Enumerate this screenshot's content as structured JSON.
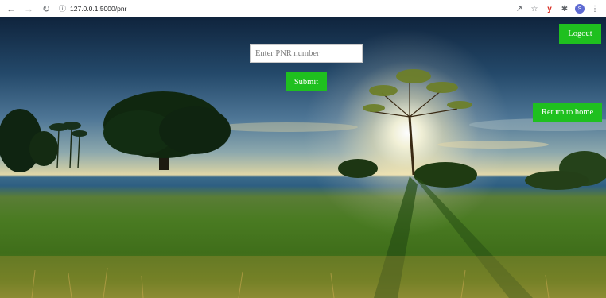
{
  "browser": {
    "url": "127.0.0.1:5000/pnr",
    "icons": {
      "back": "back-arrow-icon",
      "forward": "forward-arrow-icon",
      "reload": "reload-icon",
      "site_info": "info-icon",
      "share": "share-icon",
      "bookmark": "star-icon",
      "extension": "extension-shield-icon",
      "extensions_menu": "puzzle-icon",
      "menu": "kebab-menu-icon"
    },
    "profile_initial": "S"
  },
  "page": {
    "pnr_placeholder": "Enter PNR number",
    "pnr_value": "",
    "submit_label": "Submit",
    "logout_label": "Logout",
    "return_home_label": "Return to home",
    "button_color": "#1fc01f"
  }
}
